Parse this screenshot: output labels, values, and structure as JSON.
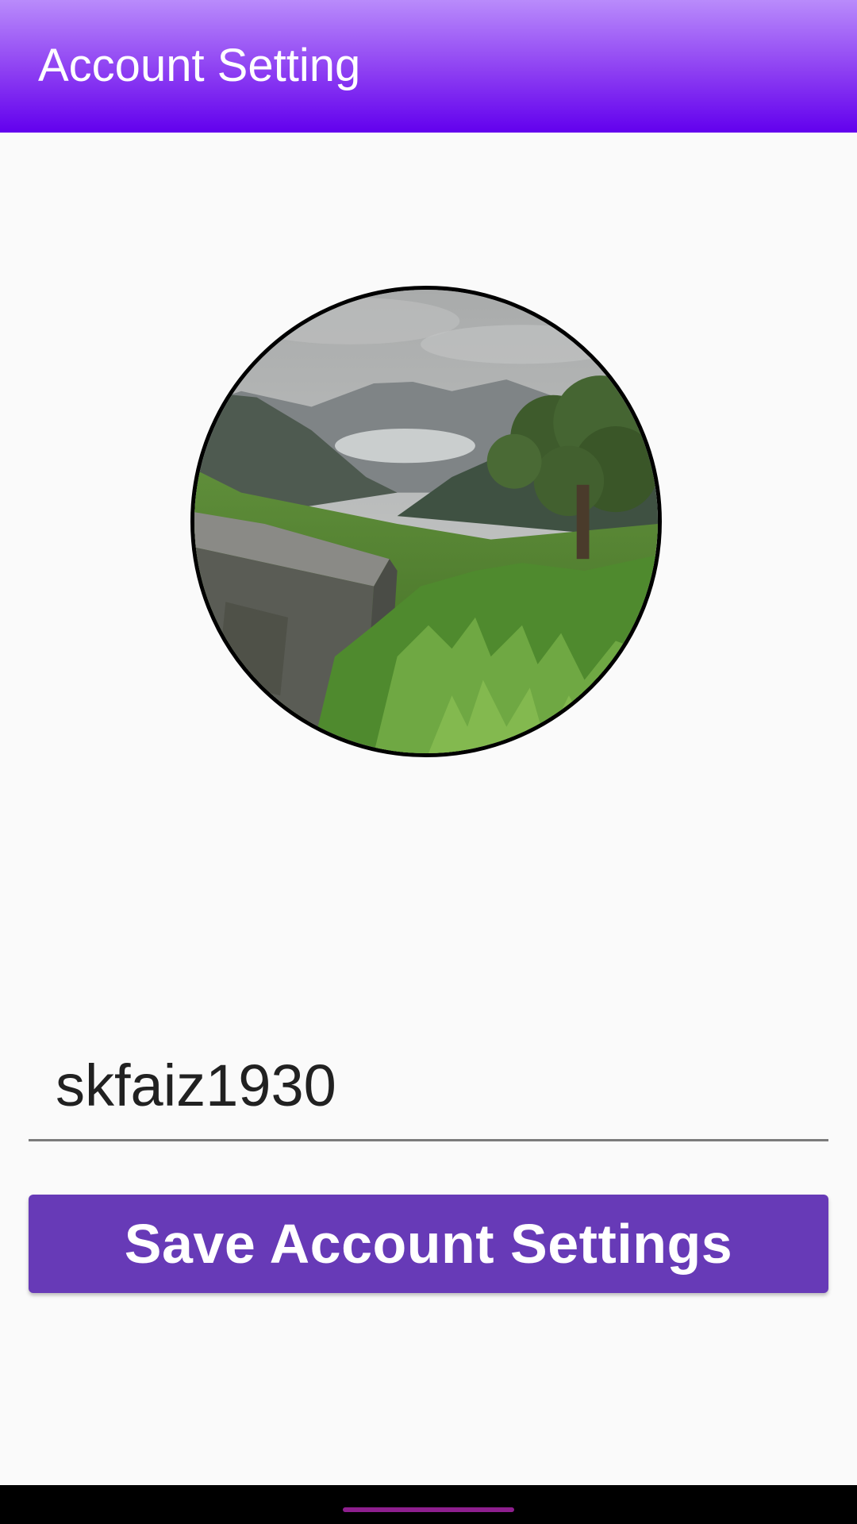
{
  "app_bar": {
    "title": "Account Setting",
    "color": "#6200ee"
  },
  "profile": {
    "avatar_image": "landscape-photo (misty mountains, green valley, tree, stone wall)"
  },
  "username_field": {
    "value": "skfaiz1930"
  },
  "save_button": {
    "label": "Save Account Settings",
    "color": "#673ab7"
  },
  "nav_bar": {
    "home_handle": "home-gesture-handle"
  }
}
